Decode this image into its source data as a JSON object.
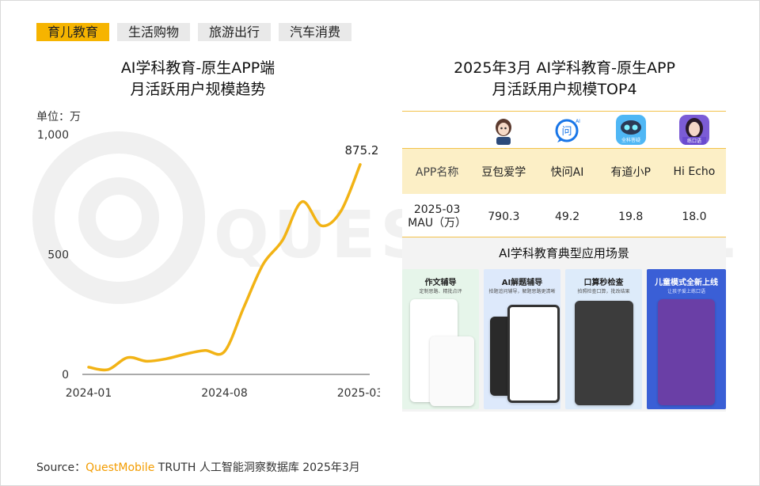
{
  "tabs": [
    "育儿教育",
    "生活购物",
    "旅游出行",
    "汽车消费"
  ],
  "left_title": [
    "AI学科教育-原生APP端",
    "月活跃用户规模趋势"
  ],
  "unit": "单位：万",
  "right_title": [
    "2025年3月 AI学科教育-原生APP",
    "月活跃用户规模TOP4"
  ],
  "table": {
    "header_label": "APP名称",
    "apps": [
      "豆包爱学",
      "快问AI",
      "有道小P",
      "Hi Echo"
    ],
    "icons": [
      "doubao-aixue-avatar-icon",
      "kuaiwen-ai-chat-icon",
      "youdao-xiaop-robot-icon",
      "hi-echo-avatar-icon"
    ],
    "icon_texts": [
      "",
      "问",
      "全科答疑",
      "练口语"
    ],
    "mau_label": [
      "2025-03",
      "MAU（万）"
    ],
    "mau_values": [
      "790.3",
      "49.2",
      "19.8",
      "18.0"
    ]
  },
  "scenes": {
    "title": "AI学科教育典型应用场景",
    "panels": [
      {
        "title": "作文辅导",
        "subtitle": "定制思路、精批点评",
        "color": "#e6f5ea"
      },
      {
        "title": "AI解题辅导",
        "subtitle": "拍题追问辅导，解题思路更清晰",
        "color": "#dde9fb"
      },
      {
        "title": "口算秒检查",
        "subtitle": "拍照检查口算，批改结果",
        "color": "#ddebfa"
      },
      {
        "title": "儿童模式全新上线",
        "subtitle": "让孩子爱上练口语",
        "color": "#3a5fd6"
      }
    ]
  },
  "watermark": "QUESTMOBILE",
  "source": {
    "prefix": "Source：",
    "brand": "QuestMobile",
    "suffix": " TRUTH 人工智能洞察数据库 2025年3月"
  },
  "colors": {
    "accent": "#f6b400",
    "line": "#f2b315",
    "table_header": "#fcefc6",
    "brand": "#f39c00"
  },
  "chart_data": {
    "type": "line",
    "x": [
      "2024-01",
      "2024-02",
      "2024-03",
      "2024-04",
      "2024-05",
      "2024-06",
      "2024-07",
      "2024-08",
      "2024-09",
      "2024-10",
      "2024-11",
      "2024-12",
      "2025-01",
      "2025-02",
      "2025-03"
    ],
    "values": [
      30,
      20,
      70,
      55,
      65,
      85,
      100,
      95,
      280,
      460,
      560,
      720,
      620,
      680,
      875.2
    ],
    "xticks": [
      "2024-01",
      "2024-08",
      "2025-03"
    ],
    "yticks": [
      0,
      500,
      1000
    ],
    "ytick_labels": [
      "0",
      "500",
      "1,000"
    ],
    "ylim": [
      0,
      1000
    ],
    "data_label": "875.2",
    "grid": false
  }
}
